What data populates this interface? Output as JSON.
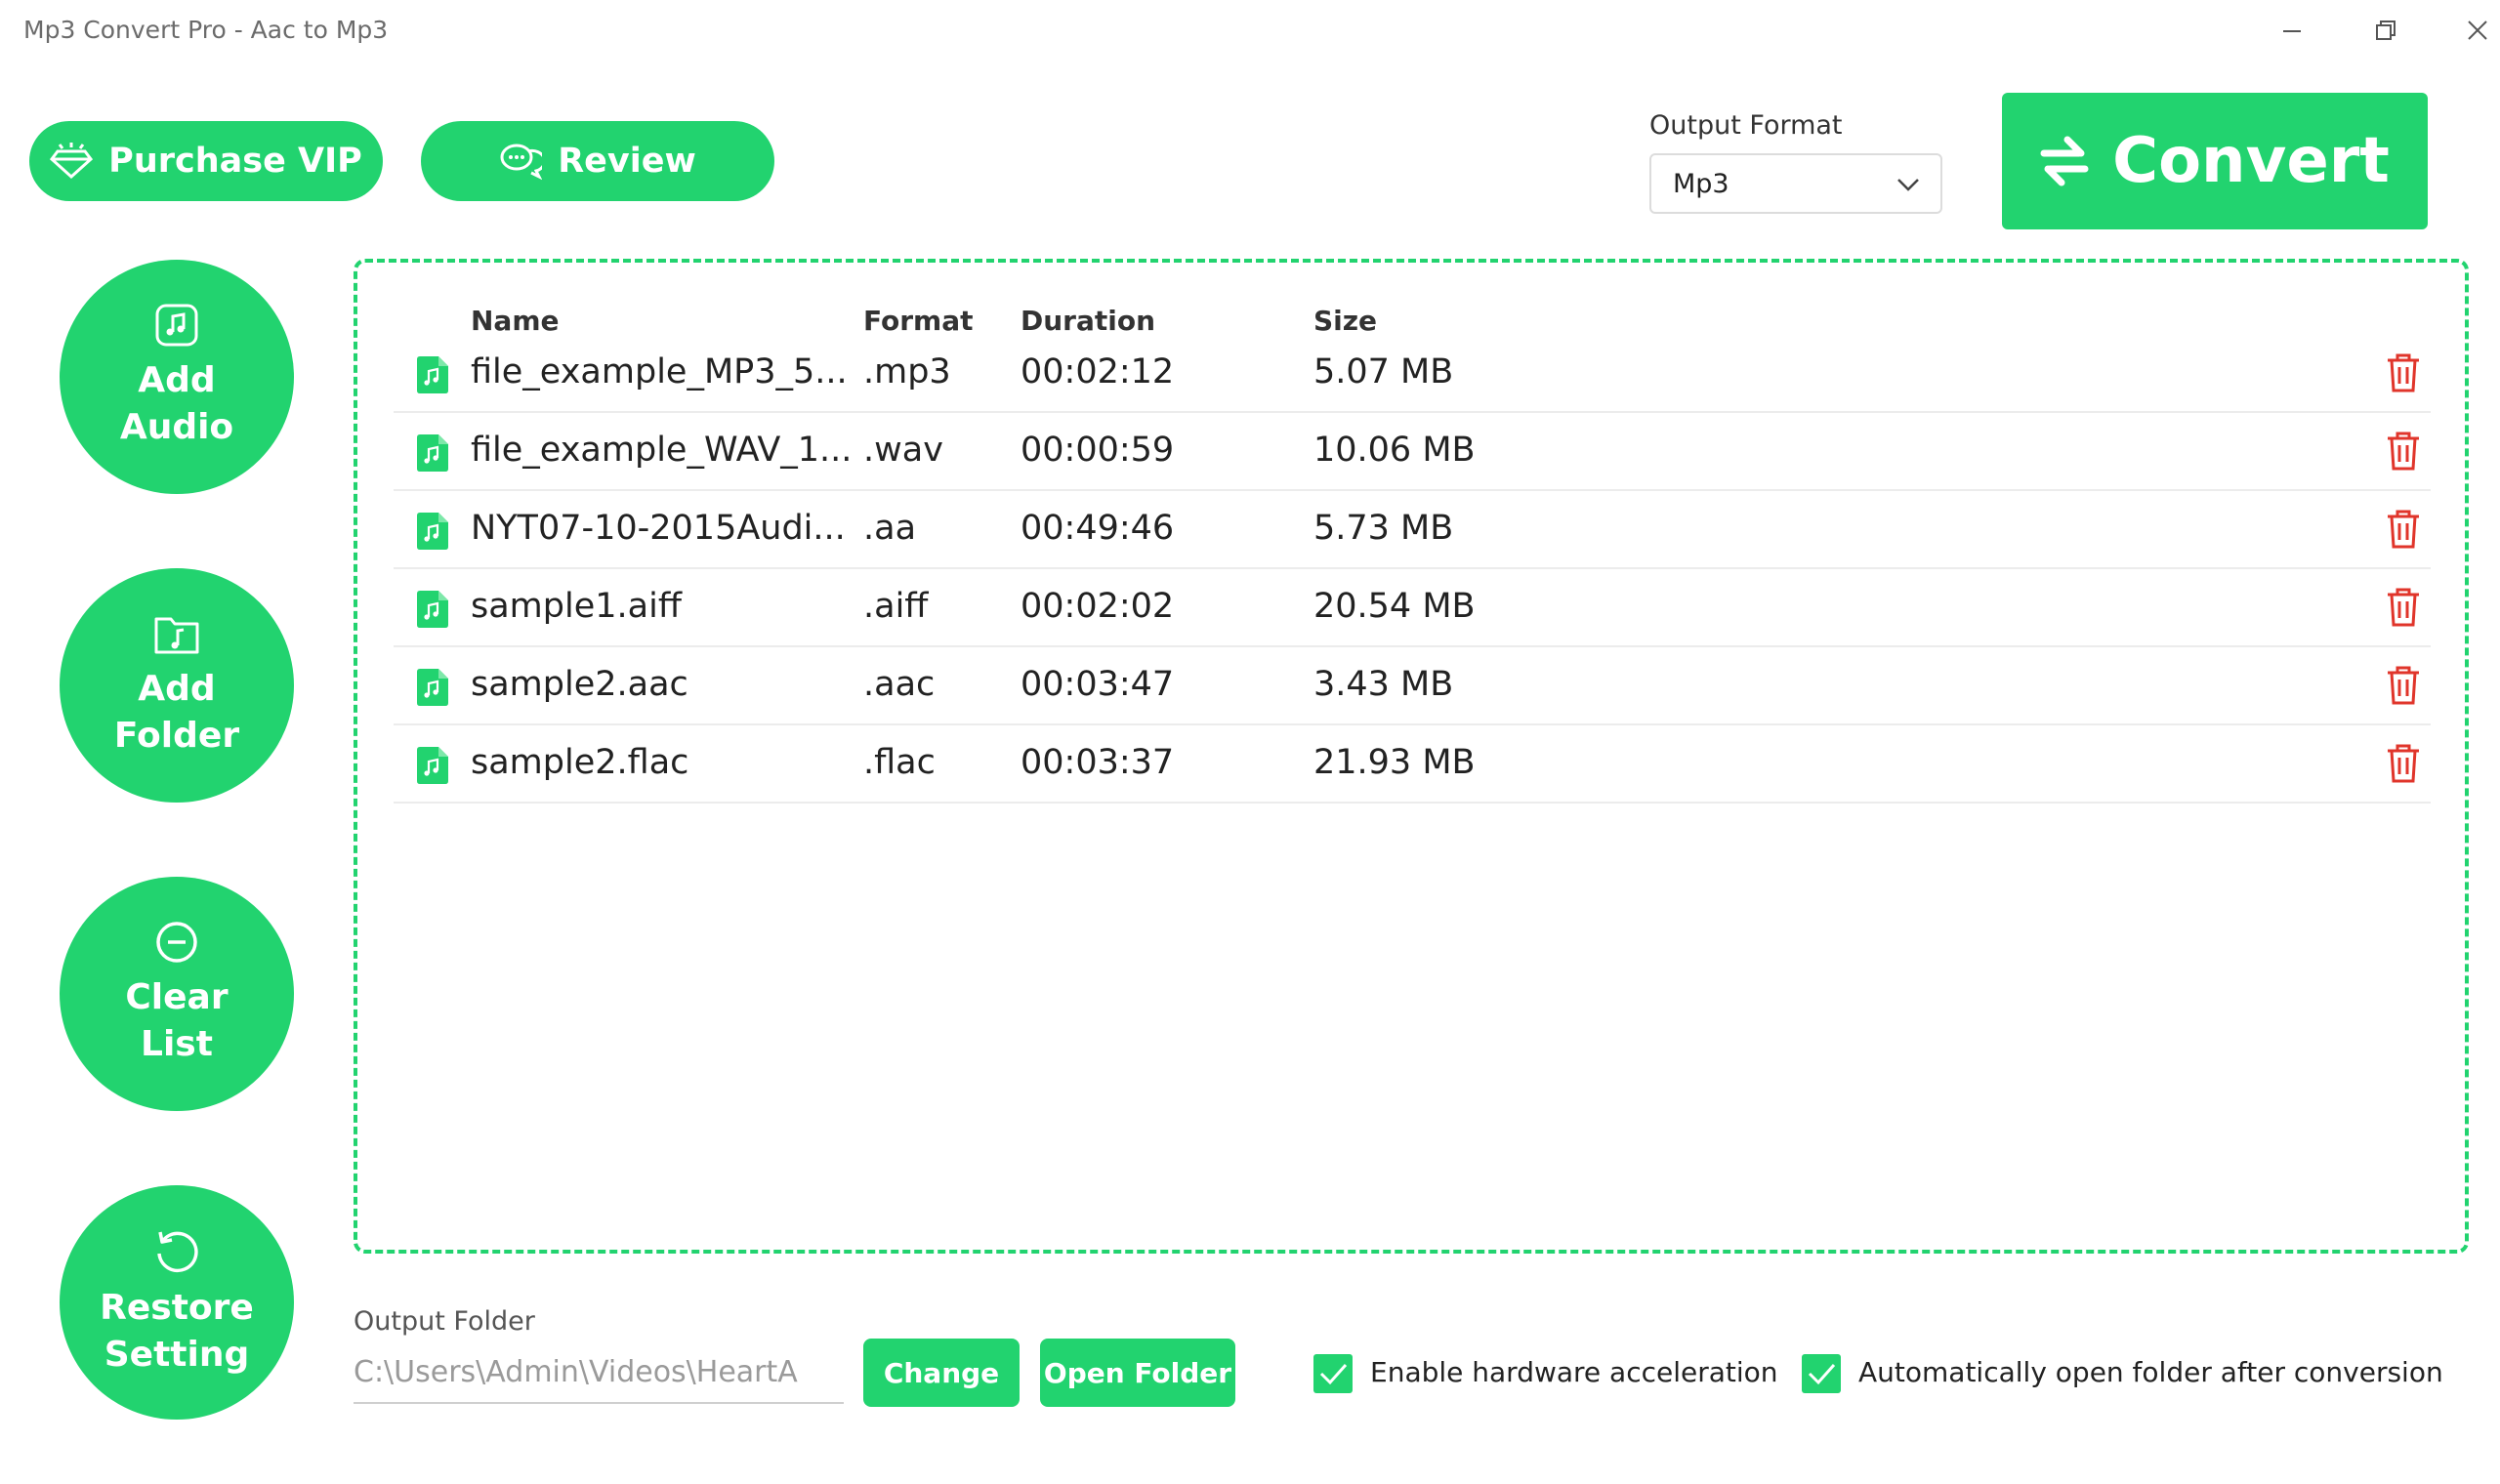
{
  "window": {
    "title": "Mp3 Convert Pro - Aac to Mp3",
    "controls": [
      "minimize-icon",
      "restore-icon",
      "close-icon"
    ]
  },
  "header": {
    "purchase_label": "Purchase VIP",
    "review_label": "Review",
    "output_format_label": "Output Format",
    "output_format_value": "Mp3",
    "convert_label": "Convert"
  },
  "sidebar": {
    "add_audio": "Add\nAudio",
    "add_folder": "Add\nFolder",
    "clear_list": "Clear\nList",
    "restore_setting": "Restore\nSetting"
  },
  "table": {
    "columns": {
      "name": "Name",
      "format": "Format",
      "duration": "Duration",
      "size": "Size"
    },
    "rows": [
      {
        "name": "file_example_MP3_5...",
        "format": ".mp3",
        "duration": "00:02:12",
        "size": "5.07 MB"
      },
      {
        "name": "file_example_WAV_1...",
        "format": ".wav",
        "duration": "00:00:59",
        "size": "10.06 MB"
      },
      {
        "name": "NYT07-10-2015Audi...",
        "format": ".aa",
        "duration": "00:49:46",
        "size": "5.73 MB"
      },
      {
        "name": "sample1.aiff",
        "format": ".aiff",
        "duration": "00:02:02",
        "size": "20.54 MB"
      },
      {
        "name": "sample2.aac",
        "format": ".aac",
        "duration": "00:03:47",
        "size": "3.43 MB"
      },
      {
        "name": "sample2.flac",
        "format": ".flac",
        "duration": "00:03:37",
        "size": "21.93 MB"
      }
    ]
  },
  "footer": {
    "output_folder_label": "Output Folder",
    "output_folder_path": "C:\\Users\\Admin\\Videos\\HeartA",
    "change_label": "Change",
    "open_folder_label": "Open Folder",
    "hw_accel_label": "Enable hardware acceleration",
    "hw_accel_checked": true,
    "auto_open_label": "Automatically open folder after conversion",
    "auto_open_checked": true
  },
  "colors": {
    "accent": "#22d36f",
    "delete": "#e0352b"
  }
}
